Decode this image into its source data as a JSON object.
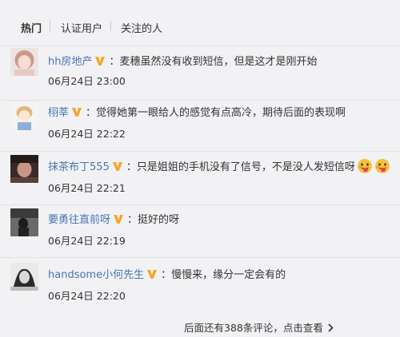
{
  "tabs": [
    {
      "label": "热门",
      "active": true
    },
    {
      "label": "认证用户",
      "active": false
    },
    {
      "label": "关注的人",
      "active": false
    }
  ],
  "comments": [
    {
      "username": "hh房地产",
      "text": "麦穗虽然没有收到短信，但是这才是刚开始",
      "time": "06月24日 23:00",
      "avatar": "avatar-girl-light"
    },
    {
      "username": "栩莘",
      "text": "觉得她第一眼给人的感觉有点高冷，期待后面的表现啊",
      "time": "06月24日 22:22",
      "avatar": "avatar-cartoon"
    },
    {
      "username": "抹茶布丁555",
      "text": "只是姐姐的手机没有了信号，不是没人发短信呀",
      "time": "06月24日 22:21",
      "avatar": "avatar-dark-face",
      "emojis": [
        "tongue-face-icon",
        "tongue-face-icon"
      ]
    },
    {
      "username": "要勇往直前呀",
      "text": "挺好的呀",
      "time": "06月24日 22:19",
      "avatar": "avatar-dark-figure"
    },
    {
      "username": "handsome小何先生",
      "text": "慢慢来，缘分一定会有的",
      "time": "06月24日 22:20",
      "avatar": "avatar-sketch"
    }
  ],
  "more_link": "后面还有388条评论，点击查看",
  "colors": {
    "username": "#4a74b5",
    "badge": "#f5a623",
    "background": "#f2f2f5"
  }
}
